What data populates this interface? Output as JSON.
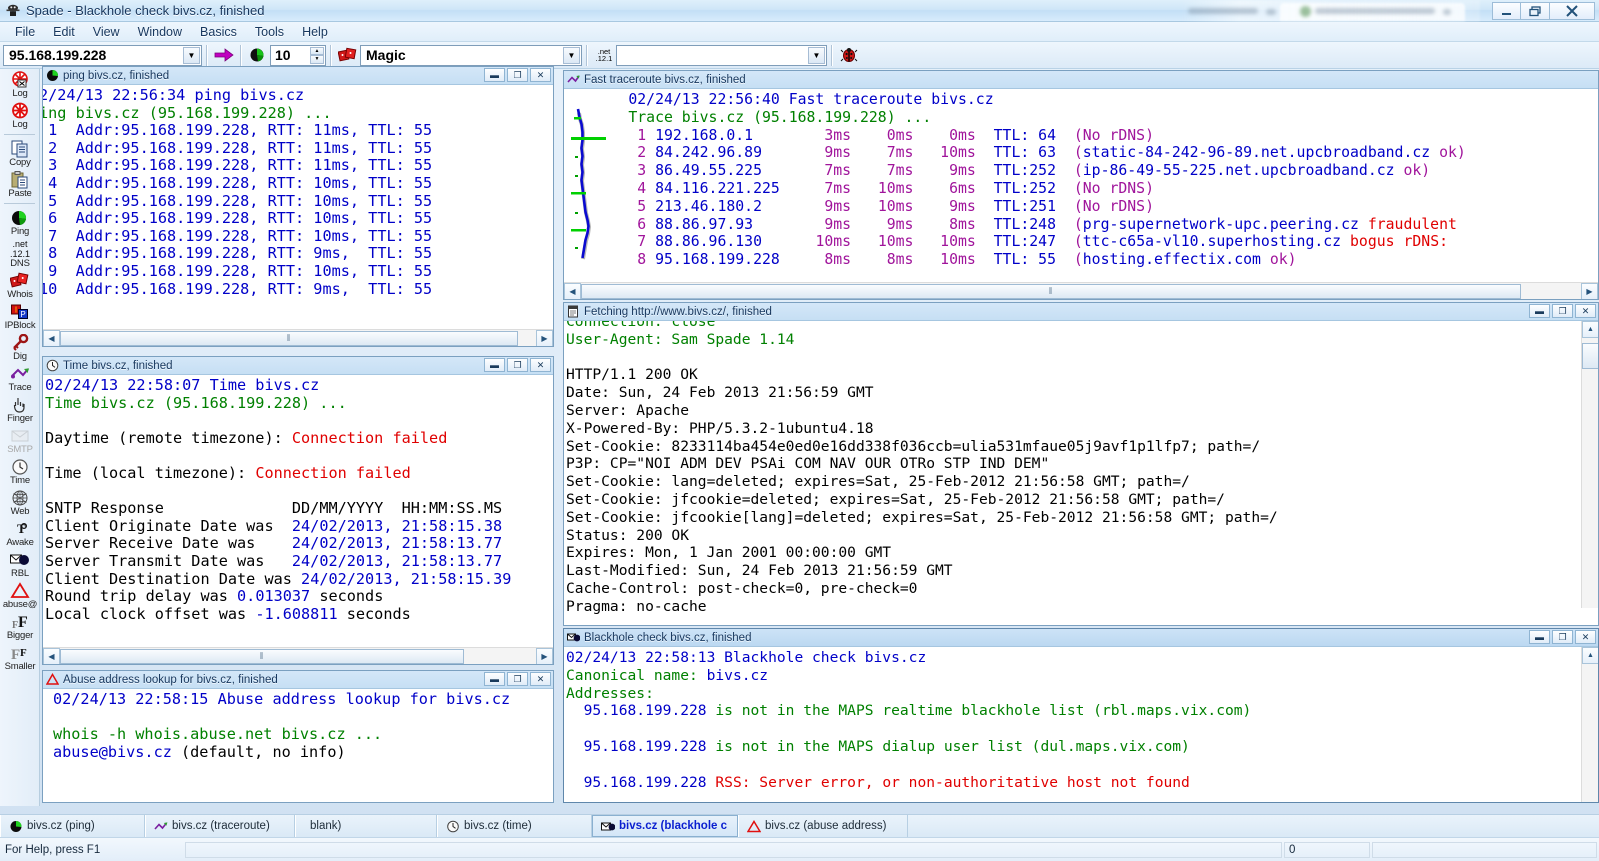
{
  "window": {
    "title": "Spade - Blackhole check bivs.cz, finished",
    "app_icon": "spade-icon",
    "buttons": {
      "minimize": "—",
      "restore": "❐",
      "close": "✕"
    }
  },
  "menubar": {
    "items": [
      "File",
      "Edit",
      "View",
      "Window",
      "Basics",
      "Tools",
      "Help"
    ]
  },
  "toolbar": {
    "address_value": "95.168.199.228",
    "go_icon": "arrow-right-icon",
    "ping_count_value": "10",
    "ping_icon": "globe-icon",
    "magic_icon": "dice-icon",
    "magic_value": "Magic",
    "dns_icon": "dns-icon",
    "dns_icon_text": [
      ".net",
      ".12.1"
    ],
    "dns_value": "",
    "bug_icon": "ladybug-icon",
    "dropdown_arrow": "▼"
  },
  "sidebar": {
    "items": [
      {
        "label": "Log",
        "icon": "log-stop-icon"
      },
      {
        "label": "Log",
        "icon": "log-icon"
      },
      {
        "sep": true
      },
      {
        "label": "Copy",
        "icon": "copy-icon"
      },
      {
        "label": "Paste",
        "icon": "paste-icon"
      },
      {
        "sep": true
      },
      {
        "label": "Ping",
        "icon": "ping-globe-icon"
      },
      {
        "label": "DNS",
        "icon": "dns-icon",
        "icon_text": [
          ".net",
          ".12.1"
        ]
      },
      {
        "label": "Whois",
        "icon": "whois-dice-icon"
      },
      {
        "label": "IPBlock",
        "icon": "ipblock-icon"
      },
      {
        "label": "Dig",
        "icon": "dig-key-icon"
      },
      {
        "label": "Trace",
        "icon": "trace-icon"
      },
      {
        "label": "Finger",
        "icon": "finger-hand-icon"
      },
      {
        "label": "SMTP",
        "icon": "smtp-icon",
        "disabled": true
      },
      {
        "label": "Time",
        "icon": "clock-icon"
      },
      {
        "label": "Web",
        "icon": "web-globe-icon"
      },
      {
        "label": "Awake",
        "icon": "awake-icon"
      },
      {
        "label": "RBL",
        "icon": "rbl-mail-icon"
      },
      {
        "label": "abuse@",
        "icon": "abuse-warning-icon"
      },
      {
        "label": "Bigger",
        "icon": "font-bigger-icon"
      },
      {
        "label": "Smaller",
        "icon": "font-smaller-icon"
      }
    ]
  },
  "windows": {
    "ping": {
      "title": "ping bivs.cz, finished",
      "icon": "ping-globe-icon",
      "lines": [
        [
          [
            "2/24/13 22:56:34 ping bivs.cz",
            "c-blue"
          ]
        ],
        [
          [
            "ing bivs.cz (95.168.199.228) ...",
            "c-green"
          ]
        ],
        [
          [
            " 1  Addr:95.168.199.228, RTT: 11ms, TTL: 55",
            "c-blue"
          ]
        ],
        [
          [
            " 2  Addr:95.168.199.228, RTT: 11ms, TTL: 55",
            "c-blue"
          ]
        ],
        [
          [
            " 3  Addr:95.168.199.228, RTT: 11ms, TTL: 55",
            "c-blue"
          ]
        ],
        [
          [
            " 4  Addr:95.168.199.228, RTT: 10ms, TTL: 55",
            "c-blue"
          ]
        ],
        [
          [
            " 5  Addr:95.168.199.228, RTT: 10ms, TTL: 55",
            "c-blue"
          ]
        ],
        [
          [
            " 6  Addr:95.168.199.228, RTT: 10ms, TTL: 55",
            "c-blue"
          ]
        ],
        [
          [
            " 7  Addr:95.168.199.228, RTT: 10ms, TTL: 55",
            "c-blue"
          ]
        ],
        [
          [
            " 8  Addr:95.168.199.228, RTT: 9ms,  TTL: 55",
            "c-blue"
          ]
        ],
        [
          [
            " 9  Addr:95.168.199.228, RTT: 10ms, TTL: 55",
            "c-blue"
          ]
        ],
        [
          [
            "10  Addr:95.168.199.228, RTT: 9ms,  TTL: 55",
            "c-blue"
          ]
        ]
      ]
    },
    "traceroute": {
      "title": "Fast traceroute bivs.cz, finished",
      "icon": "trace-icon",
      "lines": [
        [
          [
            "       02/24/13 22:56:40 Fast traceroute bivs.cz",
            "c-blue"
          ]
        ],
        [
          [
            "       Trace bivs.cz (95.168.199.228) ...",
            "c-green"
          ]
        ],
        [
          [
            "        1 ",
            "c-mag"
          ],
          [
            "192.168.0.1     ",
            "c-blue"
          ],
          [
            "   3ms    0ms    0ms  ",
            "c-mag"
          ],
          [
            "TTL: 64  ",
            "c-blue"
          ],
          [
            "(No rDNS)",
            "c-mag"
          ]
        ],
        [
          [
            "        2 ",
            "c-mag"
          ],
          [
            "84.242.96.89    ",
            "c-blue"
          ],
          [
            "   9ms    7ms   10ms  ",
            "c-mag"
          ],
          [
            "TTL: 63  ",
            "c-blue"
          ],
          [
            "(",
            "c-mag"
          ],
          [
            "static-84-242-96-89.net.upcbroadband.cz ",
            "c-blue"
          ],
          [
            "ok)",
            "c-mag"
          ]
        ],
        [
          [
            "        3 ",
            "c-mag"
          ],
          [
            "86.49.55.225    ",
            "c-blue"
          ],
          [
            "   7ms    7ms    9ms  ",
            "c-mag"
          ],
          [
            "TTL:252  ",
            "c-blue"
          ],
          [
            "(",
            "c-mag"
          ],
          [
            "ip-86-49-55-225.net.upcbroadband.cz ",
            "c-blue"
          ],
          [
            "ok)",
            "c-mag"
          ]
        ],
        [
          [
            "        4 ",
            "c-mag"
          ],
          [
            "84.116.221.225  ",
            "c-blue"
          ],
          [
            "   7ms   10ms    6ms  ",
            "c-mag"
          ],
          [
            "TTL:252  ",
            "c-blue"
          ],
          [
            "(No rDNS)",
            "c-mag"
          ]
        ],
        [
          [
            "        5 ",
            "c-mag"
          ],
          [
            "213.46.180.2    ",
            "c-blue"
          ],
          [
            "   9ms   10ms    9ms  ",
            "c-mag"
          ],
          [
            "TTL:251  ",
            "c-blue"
          ],
          [
            "(No rDNS)",
            "c-mag"
          ]
        ],
        [
          [
            "        6 ",
            "c-mag"
          ],
          [
            "88.86.97.93     ",
            "c-blue"
          ],
          [
            "   9ms    9ms    8ms  ",
            "c-mag"
          ],
          [
            "TTL:248  ",
            "c-blue"
          ],
          [
            "(",
            "c-mag"
          ],
          [
            "prg-supernetwork-upc.peering.cz ",
            "c-blue"
          ],
          [
            "fraudulent",
            "c-red"
          ]
        ],
        [
          [
            "        7 ",
            "c-mag"
          ],
          [
            "88.86.96.130    ",
            "c-blue"
          ],
          [
            "  10ms   10ms   10ms  ",
            "c-mag"
          ],
          [
            "TTL:247  ",
            "c-blue"
          ],
          [
            "(",
            "c-mag"
          ],
          [
            "ttc-c65a-vl10.superhosting.cz ",
            "c-blue"
          ],
          [
            "bogus rDNS:",
            "c-red"
          ]
        ],
        [
          [
            "        8 ",
            "c-mag"
          ],
          [
            "95.168.199.228  ",
            "c-blue"
          ],
          [
            "   8ms    8ms   10ms  ",
            "c-mag"
          ],
          [
            "TTL: 55  ",
            "c-blue"
          ],
          [
            "(",
            "c-mag"
          ],
          [
            "hosting.effectix.com ",
            "c-blue"
          ],
          [
            "ok)",
            "c-mag"
          ]
        ]
      ]
    },
    "time": {
      "title": "Time bivs.cz, finished",
      "icon": "clock-icon",
      "lines": [
        [
          [
            "02/24/13 22:58:07 Time bivs.cz",
            "c-blue"
          ]
        ],
        [
          [
            "Time bivs.cz (95.168.199.228) ...",
            "c-green"
          ]
        ],
        [
          [
            "",
            "c-black"
          ]
        ],
        [
          [
            "Daytime (remote timezone): ",
            "c-black"
          ],
          [
            "Connection failed",
            "c-red"
          ]
        ],
        [
          [
            "",
            "c-black"
          ]
        ],
        [
          [
            "Time (local timezone): ",
            "c-black"
          ],
          [
            "Connection failed",
            "c-red"
          ]
        ],
        [
          [
            "",
            "c-black"
          ]
        ],
        [
          [
            "SNTP Response              ",
            "c-black"
          ],
          [
            "DD/MM/YYYY  HH:MM:SS.MS",
            "c-black"
          ]
        ],
        [
          [
            "Client Originate Date was  ",
            "c-black"
          ],
          [
            "24/02/2013, 21:58:15.38",
            "c-blue"
          ]
        ],
        [
          [
            "Server Receive Date was    ",
            "c-black"
          ],
          [
            "24/02/2013, 21:58:13.77",
            "c-blue"
          ]
        ],
        [
          [
            "Server Transmit Date was   ",
            "c-black"
          ],
          [
            "24/02/2013, 21:58:13.77",
            "c-blue"
          ]
        ],
        [
          [
            "Client Destination Date was",
            "c-black"
          ],
          [
            " ",
            "c-black"
          ],
          [
            "24/02/2013, 21:58:15.39",
            "c-blue"
          ]
        ],
        [
          [
            "Round trip delay was ",
            "c-black"
          ],
          [
            "0.013037",
            "c-blue"
          ],
          [
            " seconds",
            "c-black"
          ]
        ],
        [
          [
            "Local clock offset was ",
            "c-black"
          ],
          [
            "-1.608811",
            "c-blue"
          ],
          [
            " seconds",
            "c-black"
          ]
        ]
      ]
    },
    "abuse": {
      "title": "Abuse address lookup for bivs.cz, finished",
      "icon": "abuse-warning-icon",
      "lines": [
        [
          [
            "02/24/13 22:58:15 Abuse address lookup for bivs.cz",
            "c-blue"
          ]
        ],
        [
          [
            "",
            "c-black"
          ]
        ],
        [
          [
            "whois -h whois.abuse.net bivs.cz ...",
            "c-green"
          ]
        ],
        [
          [
            "abuse@bivs.cz",
            "c-blue"
          ],
          [
            " (default, no info)",
            "c-black"
          ]
        ]
      ]
    },
    "fetch": {
      "title": "Fetching http://www.bivs.cz/, finished",
      "icon": "doc-icon",
      "lines": [
        [
          [
            "Connection: close",
            "c-green"
          ]
        ],
        [
          [
            "User-Agent: Sam Spade 1.14",
            "c-green"
          ]
        ],
        [
          [
            "",
            "c-black"
          ]
        ],
        [
          [
            "HTTP/1.1 200 OK",
            "c-black"
          ]
        ],
        [
          [
            "Date: Sun, 24 Feb 2013 21:56:59 GMT",
            "c-black"
          ]
        ],
        [
          [
            "Server: Apache",
            "c-black"
          ]
        ],
        [
          [
            "X-Powered-By: PHP/5.3.2-1ubuntu4.18",
            "c-black"
          ]
        ],
        [
          [
            "Set-Cookie: 8233114ba454e0ed0e16dd338f036ccb=ulia531mfaue05j9avf1p1lfp7; path=/",
            "c-black"
          ]
        ],
        [
          [
            "P3P: CP=\"NOI ADM DEV PSAi COM NAV OUR OTRo STP IND DEM\"",
            "c-black"
          ]
        ],
        [
          [
            "Set-Cookie: lang=deleted; expires=Sat, 25-Feb-2012 21:56:58 GMT; path=/",
            "c-black"
          ]
        ],
        [
          [
            "Set-Cookie: jfcookie=deleted; expires=Sat, 25-Feb-2012 21:56:58 GMT; path=/",
            "c-black"
          ]
        ],
        [
          [
            "Set-Cookie: jfcookie[lang]=deleted; expires=Sat, 25-Feb-2012 21:56:58 GMT; path=/",
            "c-black"
          ]
        ],
        [
          [
            "Status: 200 OK",
            "c-black"
          ]
        ],
        [
          [
            "Expires: Mon, 1 Jan 2001 00:00:00 GMT",
            "c-black"
          ]
        ],
        [
          [
            "Last-Modified: Sun, 24 Feb 2013 21:56:59 GMT",
            "c-black"
          ]
        ],
        [
          [
            "Cache-Control: post-check=0, pre-check=0",
            "c-black"
          ]
        ],
        [
          [
            "Pragma: no-cache",
            "c-black"
          ]
        ]
      ]
    },
    "blackhole": {
      "title": "Blackhole check bivs.cz, finished",
      "icon": "rbl-mail-icon",
      "lines": [
        [
          [
            "02/24/13 22:58:13 Blackhole check bivs.cz",
            "c-blue"
          ]
        ],
        [
          [
            "Canonical name: ",
            "c-green"
          ],
          [
            "bivs.cz",
            "c-blue"
          ]
        ],
        [
          [
            "Addresses:",
            "c-green"
          ]
        ],
        [
          [
            "  ",
            "c-black"
          ],
          [
            "95.168.199.228",
            "c-blue"
          ],
          [
            " is not in the MAPS realtime blackhole list (rbl.maps.vix.com)",
            "c-green"
          ]
        ],
        [
          [
            "",
            "c-black"
          ]
        ],
        [
          [
            "  ",
            "c-black"
          ],
          [
            "95.168.199.228",
            "c-blue"
          ],
          [
            " is not in the MAPS dialup user list (dul.maps.vix.com)",
            "c-green"
          ]
        ],
        [
          [
            "",
            "c-black"
          ]
        ],
        [
          [
            "  ",
            "c-black"
          ],
          [
            "95.168.199.228",
            "c-blue"
          ],
          [
            " RSS: Server error, or non-authoritative host not found",
            "c-red"
          ]
        ]
      ]
    }
  },
  "taskbar": {
    "items": [
      {
        "label": "bivs.cz (ping)",
        "icon": "ping-globe-icon",
        "active": false
      },
      {
        "label": "bivs.cz (traceroute)",
        "icon": "trace-icon",
        "active": false
      },
      {
        "label": "blank)",
        "icon": "none",
        "active": false
      },
      {
        "label": "bivs.cz (time)",
        "icon": "clock-icon",
        "active": false
      },
      {
        "label": "bivs.cz (blackhole c",
        "icon": "rbl-mail-icon",
        "active": true
      },
      {
        "label": "bivs.cz (abuse address)",
        "icon": "abuse-warning-icon",
        "active": false
      }
    ]
  },
  "statusbar": {
    "help_text": "For Help, press F1",
    "pane2": "",
    "pane3": "0",
    "pane4": ""
  }
}
